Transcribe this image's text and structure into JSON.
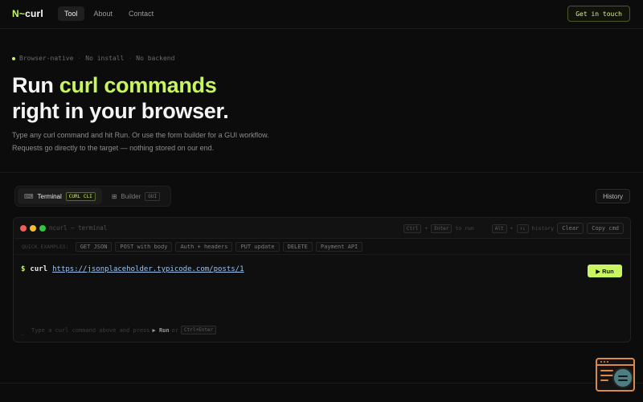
{
  "nav": {
    "logo_prefix": "N",
    "logo_symbol": "~",
    "logo_name": "curl",
    "links": [
      "Tool",
      "About",
      "Contact"
    ],
    "cta": "Get in touch"
  },
  "hero": {
    "tags": [
      "Browser-native",
      "No install",
      "No backend"
    ],
    "title_part1": "Run ",
    "title_accent": "curl commands",
    "title_line2": "right in your browser.",
    "desc_line1": "Type any curl command and hit Run. Or use the form builder for a GUI workflow.",
    "desc_line2": "Requests go directly to the target — nothing stored on our end."
  },
  "tabs": [
    {
      "icon": "⌨",
      "label": "Terminal",
      "badge": "CURL CLI"
    },
    {
      "icon": "⊞",
      "label": "Builder",
      "badge": "GUI"
    }
  ],
  "history_label": "History",
  "terminal": {
    "title": "ncurl — terminal",
    "shortcut1_keys": [
      "Ctrl",
      "Enter"
    ],
    "shortcut1_label": "to run",
    "shortcut2_keys": [
      "Alt",
      "↑↓"
    ],
    "shortcut2_label": "history",
    "clear_label": "Clear",
    "copy_label": "Copy cmd",
    "quick_label": "QUICK EXAMPLES:",
    "quick_examples": [
      "GET JSON",
      "POST with body",
      "Auth + headers",
      "PUT update",
      "DELETE",
      "Payment API"
    ],
    "prompt": "$",
    "command": "curl",
    "url": "https://jsonplaceholder.typicode.com/posts/1",
    "run_label": "▶ Run",
    "hint_pre": "Type a curl command above and press",
    "hint_run": "▶ Run",
    "hint_or": "or",
    "hint_key": "Ctrl+Enter",
    "hint_marker": "_"
  },
  "colors": {
    "accent": "#c8f560",
    "background": "#0c0c0c",
    "widget": "#d78a4c",
    "light_red": "#ee5f57",
    "light_yellow": "#f6be2f",
    "light_green": "#2fc741"
  },
  "widget_icon": "terminal-search-icon"
}
